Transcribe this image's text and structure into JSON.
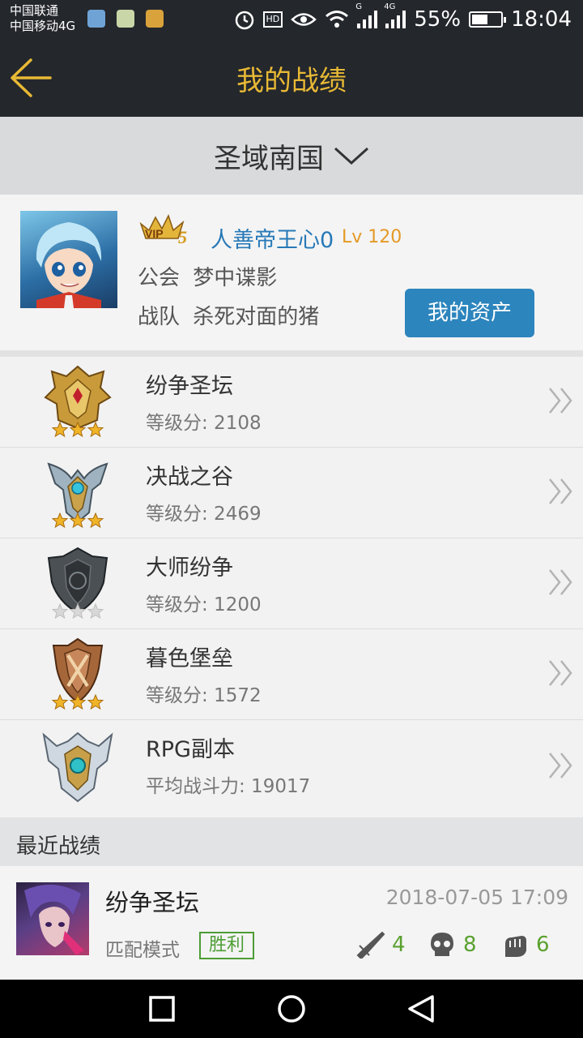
{
  "status_bar": {
    "carrier_1": "中国联通",
    "carrier_2": "中国移动4G",
    "hd": "HD",
    "net_1": "G",
    "net_2": "4G",
    "battery": "55%",
    "battery_level": 0.55,
    "time": "18:04"
  },
  "header": {
    "title": "我的战绩",
    "accent_color": "#e8b935",
    "background": "#24272c"
  },
  "server": {
    "name": "圣域南国"
  },
  "profile": {
    "vip_label": "VIP",
    "vip_level": "5",
    "name": "人善帝王心0",
    "level": "Lv 120",
    "guild_label": "公会",
    "guild": "梦中谍影",
    "team_label": "战队",
    "team": "杀死对面的猪",
    "assets_button": "我的资产"
  },
  "modes": [
    {
      "name": "纷争圣坛",
      "score": "等级分: 2108",
      "badge": "gold-rank-badge-icon",
      "stars": 3
    },
    {
      "name": "决战之谷",
      "score": "等级分: 2469",
      "badge": "silver-blue-rank-badge-icon",
      "stars": 3
    },
    {
      "name": "大师纷争",
      "score": "等级分: 1200",
      "badge": "dark-shield-badge-icon",
      "stars": 0
    },
    {
      "name": "暮色堡垒",
      "score": "等级分: 1572",
      "badge": "bronze-rank-badge-icon",
      "stars": 3
    },
    {
      "name": "RPG副本",
      "score": "平均战斗力: 19017",
      "badge": "rpg-dungeon-badge-icon",
      "stars": 0
    }
  ],
  "recent": {
    "section_title": "最近战绩",
    "match": {
      "mode": "纷争圣坛",
      "time": "2018-07-05 17:09",
      "type": "匹配模式",
      "result": "胜利",
      "kills": "4",
      "deaths": "8",
      "assists": "6"
    }
  },
  "colors": {
    "link_blue": "#2779b7",
    "level_orange": "#e49a25",
    "button_blue": "#2c85bd",
    "win_green": "#4c9d34"
  }
}
